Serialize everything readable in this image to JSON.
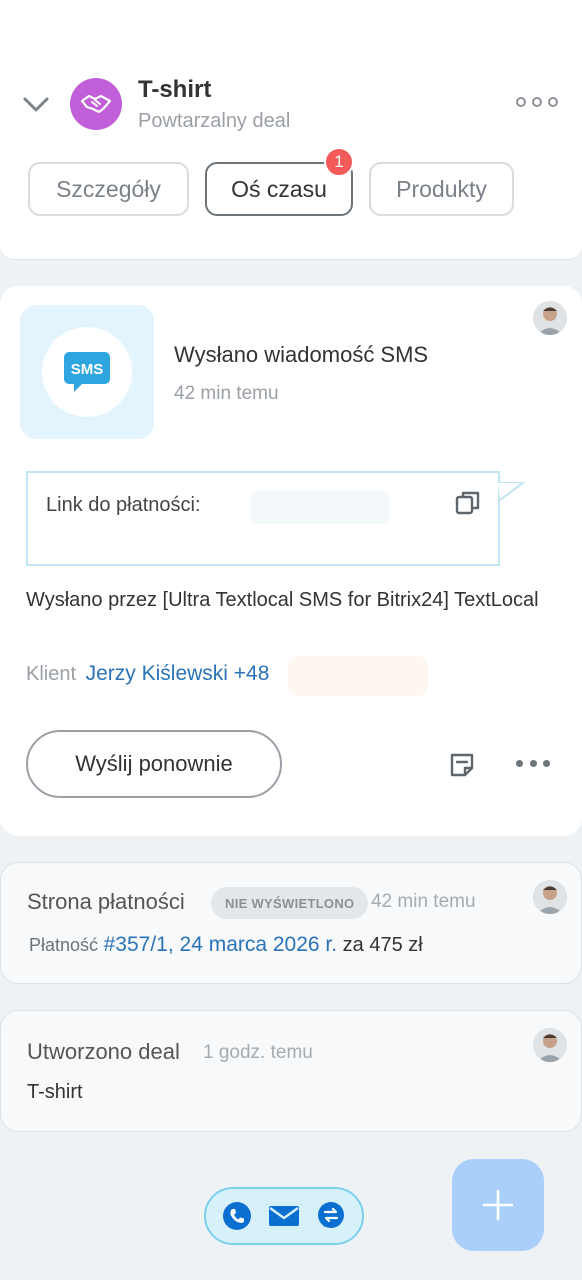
{
  "header": {
    "title": "T-shirt",
    "subtitle": "Powtarzalny deal",
    "deal_icon": "handshake-icon"
  },
  "tabs": [
    {
      "label": "Szczegóły",
      "active": false
    },
    {
      "label": "Oś czasu",
      "active": true,
      "badge": "1"
    },
    {
      "label": "Produkty",
      "active": false
    }
  ],
  "sms_activity": {
    "icon_text": "SMS",
    "title": "Wysłano wiadomość SMS",
    "time": "42 min temu",
    "message_label": "Link do płatności:",
    "sent_by": "Wysłano przez [Ultra Textlocal SMS for Bitrix24] TextLocal",
    "client_label": "Klient",
    "client_name": "Jerzy Kiślewski +48",
    "resend_label": "Wyślij ponownie"
  },
  "payment_activity": {
    "title": "Strona płatności",
    "status": "NIE WYŚWIETLONO",
    "time": "42 min temu",
    "payment_label": "Płatność",
    "payment_link": "#357/1, 24 marca 2026 r.",
    "amount": "za 475 zł"
  },
  "deal_created": {
    "title": "Utworzono deal",
    "time": "1 godz. temu",
    "deal_name": "T-shirt"
  },
  "colors": {
    "accent": "#2a73b8",
    "badge": "#f35b58",
    "deal_avatar": "#c15fd9",
    "fab": "#a9cffa",
    "sms": "#2fa6e0"
  }
}
